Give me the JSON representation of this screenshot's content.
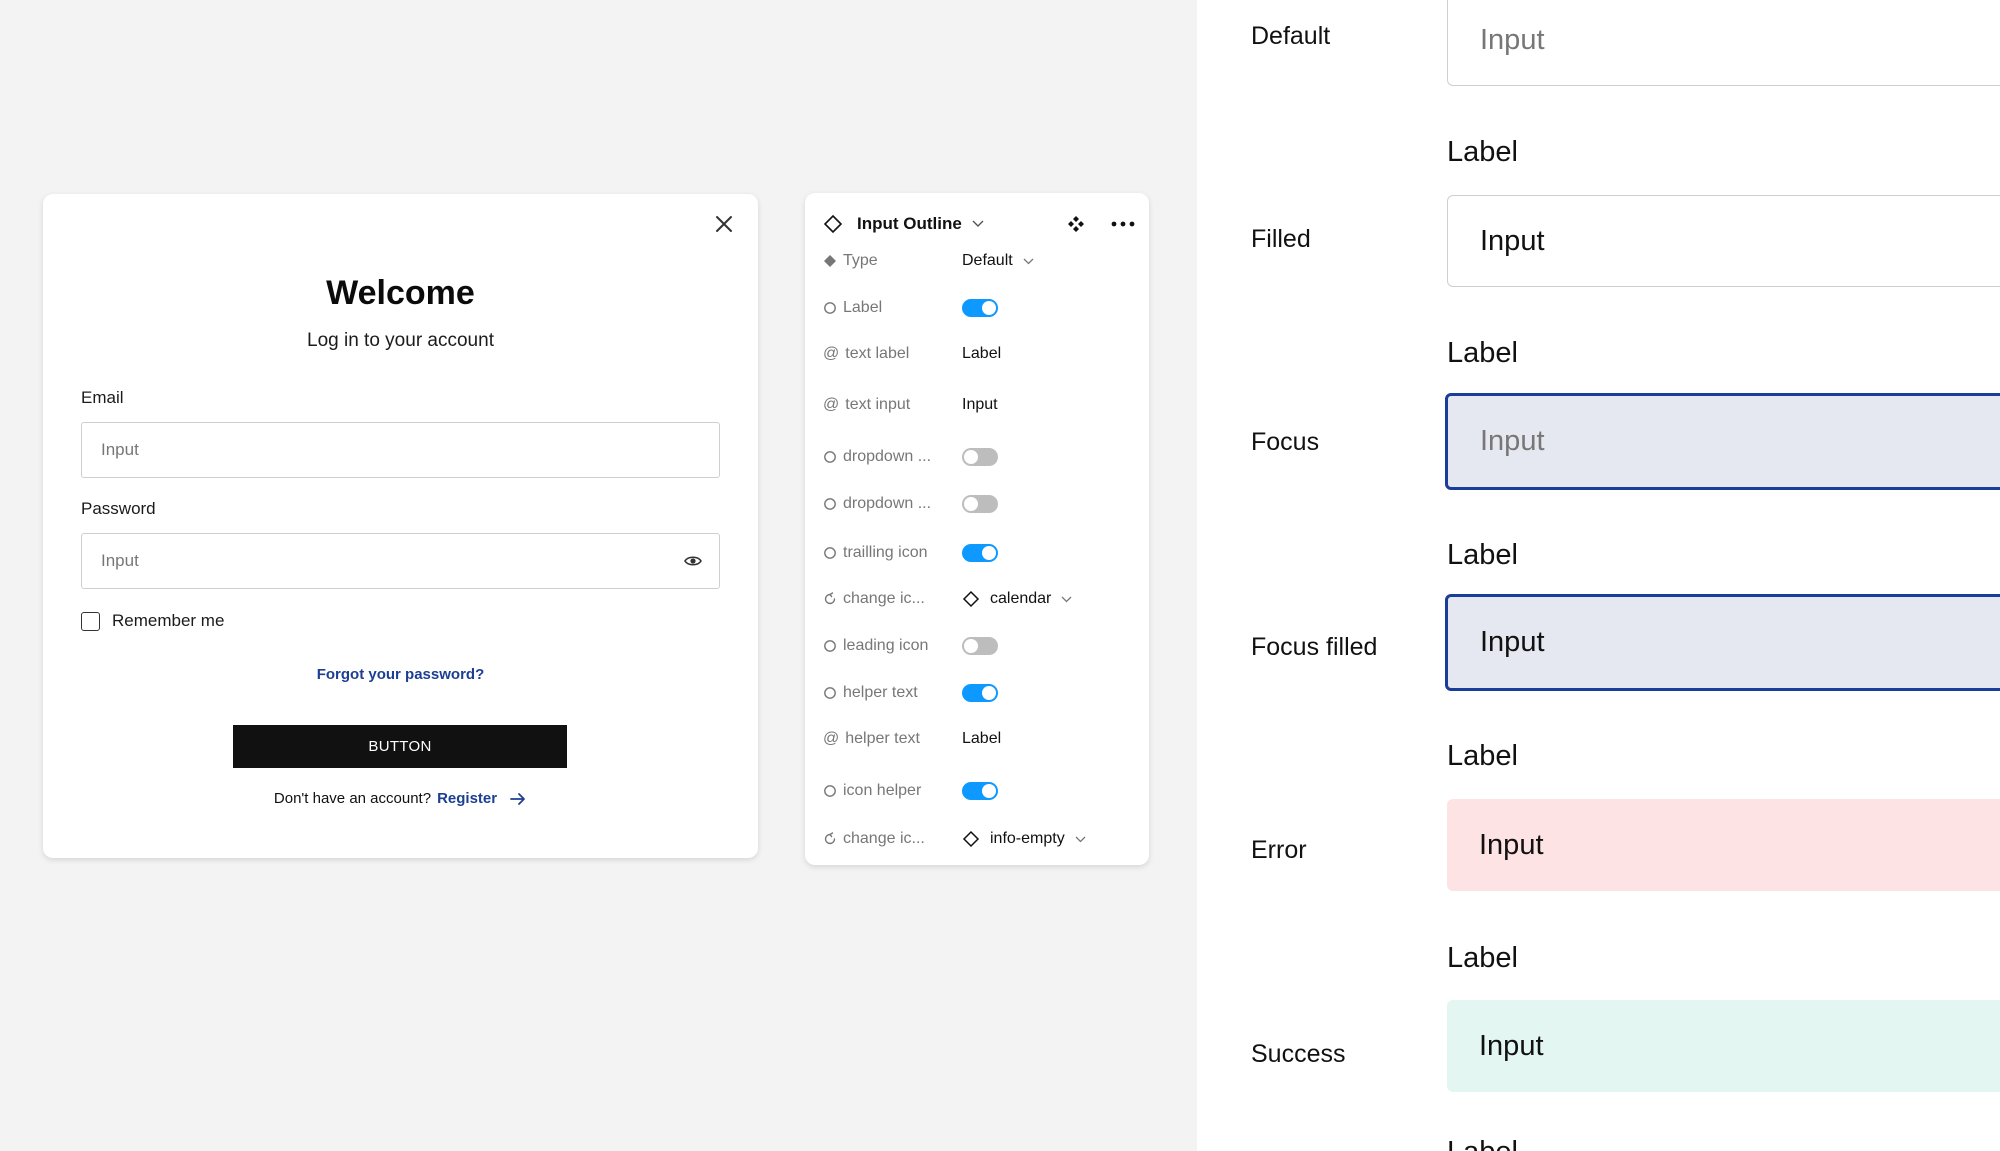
{
  "login": {
    "title": "Welcome",
    "subtitle": "Log in to your account",
    "email_label": "Email",
    "email_placeholder": "Input",
    "password_label": "Password",
    "password_placeholder": "Input",
    "remember_label": "Remember me",
    "forgot_link": "Forgot your password?",
    "button_label": "BUTTON",
    "no_account_text": "Don't have an account?",
    "register_link": "Register"
  },
  "panel": {
    "title": "Input Outline",
    "rows": [
      {
        "label": "Type",
        "kind": "variant",
        "value": "Default"
      },
      {
        "label": "Label",
        "kind": "boolean",
        "on": true
      },
      {
        "label": "text label",
        "kind": "text",
        "value": "Label"
      },
      {
        "label": "text input",
        "kind": "text",
        "value": "Input"
      },
      {
        "label": "dropdown ...",
        "kind": "boolean",
        "on": false
      },
      {
        "label": "dropdown ...",
        "kind": "boolean",
        "on": false
      },
      {
        "label": "trailling icon",
        "kind": "boolean",
        "on": true
      },
      {
        "label": "change ic...",
        "kind": "instance",
        "value": "calendar"
      },
      {
        "label": "leading icon",
        "kind": "boolean",
        "on": false
      },
      {
        "label": "helper text",
        "kind": "boolean",
        "on": true
      },
      {
        "label": "helper text",
        "kind": "text",
        "value": "Label"
      },
      {
        "label": "icon helper",
        "kind": "boolean",
        "on": true
      },
      {
        "label": "change ic...",
        "kind": "instance",
        "value": "info-empty"
      }
    ]
  },
  "showcase": {
    "states": [
      {
        "name": "Default",
        "label": "",
        "input": "Input",
        "variant": "default"
      },
      {
        "name": "Filled",
        "label": "Label",
        "input": "Input",
        "variant": "filled"
      },
      {
        "name": "Focus",
        "label": "Label",
        "input": "Input",
        "variant": "focus"
      },
      {
        "name": "Focus filled",
        "label": "Label",
        "input": "Input",
        "variant": "focusfilled"
      },
      {
        "name": "Error",
        "label": "Label",
        "input": "Input",
        "variant": "error"
      },
      {
        "name": "Success",
        "label": "Label",
        "input": "Input",
        "variant": "success"
      }
    ]
  },
  "colors": {
    "accent_blue": "#1a3d9a",
    "toggle_on": "#0d99ff",
    "focus_bg": "#e6e8f1",
    "error_bg": "#fde3e4",
    "success_bg": "#e3f6f1",
    "link": "#1d3f93"
  }
}
